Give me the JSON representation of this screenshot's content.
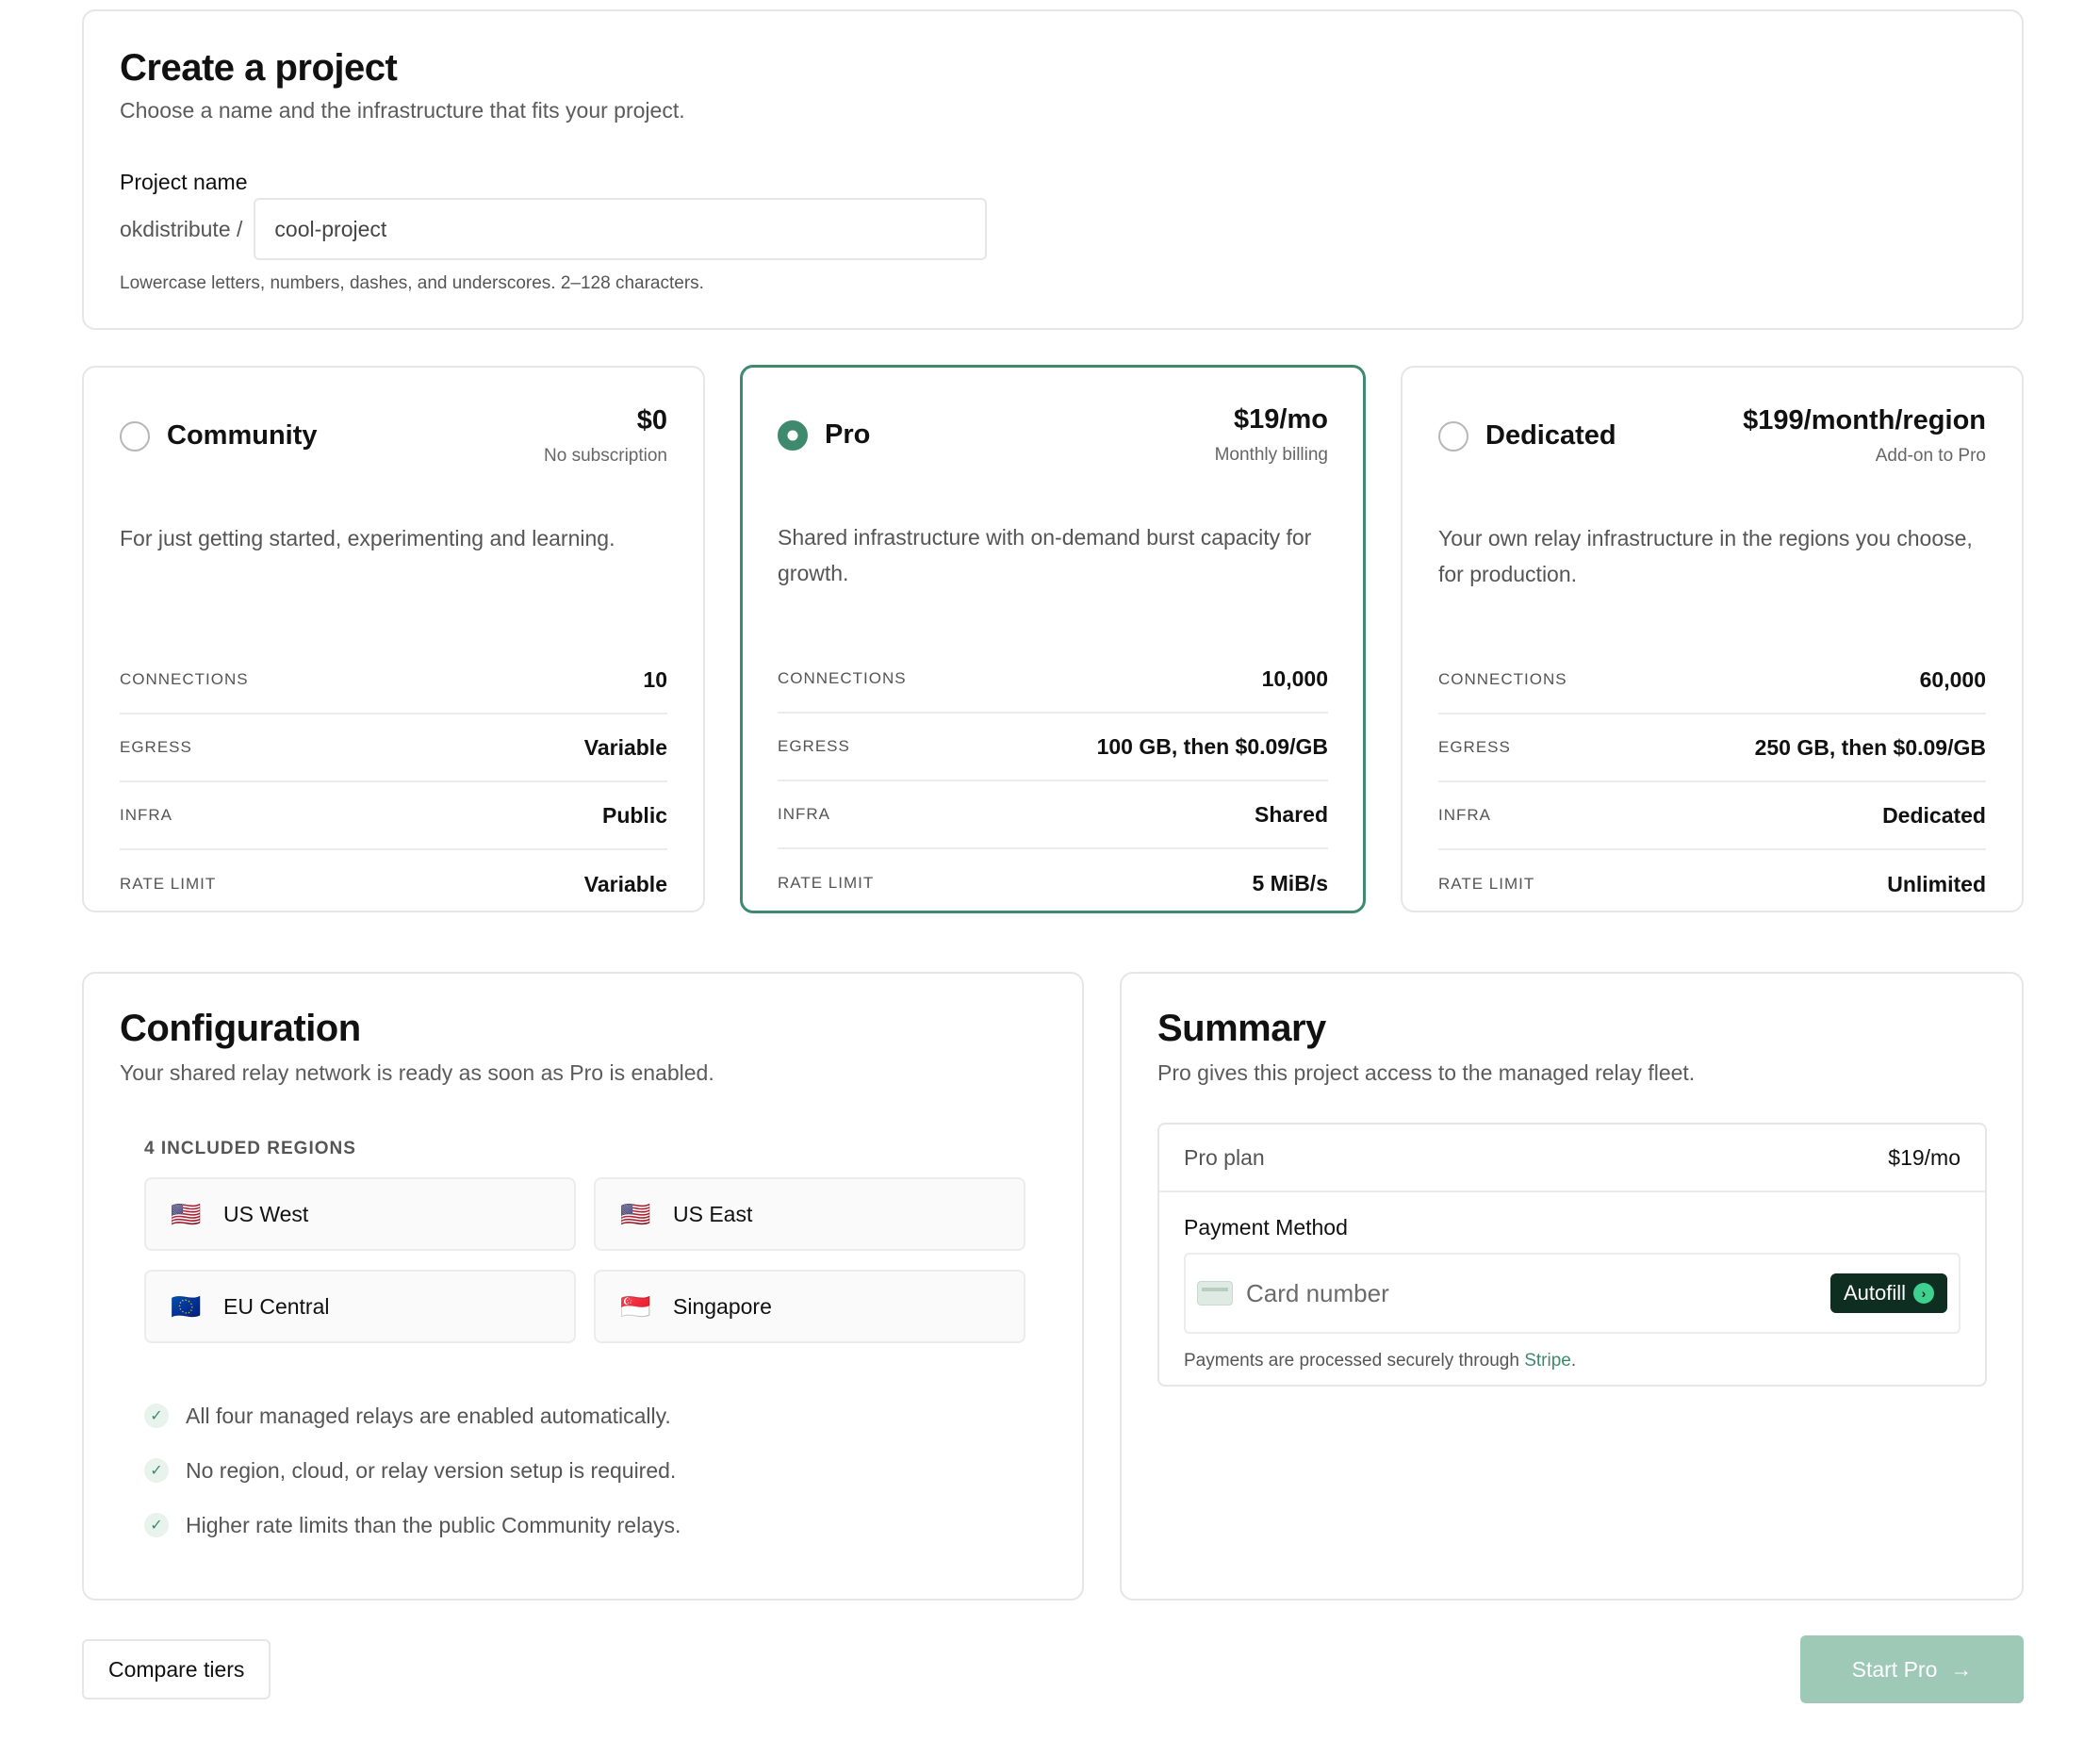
{
  "create": {
    "title": "Create a project",
    "subtitle": "Choose a name and the infrastructure that fits your project.",
    "name_label": "Project name",
    "prefix": "okdistribute /",
    "name_value": "cool-project",
    "hint": "Lowercase letters, numbers, dashes, and underscores. 2–128 characters."
  },
  "plans": [
    {
      "name": "Community",
      "price": "$0",
      "price_note": "No subscription",
      "selected": false,
      "description": "For just getting started, experimenting and learning.",
      "specs": [
        {
          "k": "CONNECTIONS",
          "v": "10"
        },
        {
          "k": "EGRESS",
          "v": "Variable"
        },
        {
          "k": "INFRA",
          "v": "Public"
        },
        {
          "k": "RATE LIMIT",
          "v": "Variable"
        }
      ]
    },
    {
      "name": "Pro",
      "price": "$19/mo",
      "price_note": "Monthly billing",
      "selected": true,
      "description": "Shared infrastructure with on-demand burst capacity for growth.",
      "specs": [
        {
          "k": "CONNECTIONS",
          "v": "10,000"
        },
        {
          "k": "EGRESS",
          "v": "100 GB, then $0.09/GB"
        },
        {
          "k": "INFRA",
          "v": "Shared"
        },
        {
          "k": "RATE LIMIT",
          "v": "5 MiB/s"
        }
      ]
    },
    {
      "name": "Dedicated",
      "price": "$199/month/region",
      "price_note": "Add-on to Pro",
      "selected": false,
      "description": "Your own relay infrastructure in the regions you choose, for production.",
      "specs": [
        {
          "k": "CONNECTIONS",
          "v": "60,000"
        },
        {
          "k": "EGRESS",
          "v": "250 GB, then $0.09/GB"
        },
        {
          "k": "INFRA",
          "v": "Dedicated"
        },
        {
          "k": "RATE LIMIT",
          "v": "Unlimited"
        }
      ]
    }
  ],
  "config": {
    "title": "Configuration",
    "subtitle": "Your shared relay network is ready as soon as Pro is enabled.",
    "regions_label": "4 INCLUDED REGIONS",
    "regions": [
      {
        "flag": "🇺🇸",
        "name": "US West"
      },
      {
        "flag": "🇺🇸",
        "name": "US East"
      },
      {
        "flag": "🇪🇺",
        "name": "EU Central"
      },
      {
        "flag": "🇸🇬",
        "name": "Singapore"
      }
    ],
    "bullets": [
      "All four managed relays are enabled automatically.",
      "No region, cloud, or relay version setup is required.",
      "Higher rate limits than the public Community relays."
    ]
  },
  "summary": {
    "title": "Summary",
    "subtitle": "Pro gives this project access to the managed relay fleet.",
    "plan_label": "Pro plan",
    "plan_price": "$19/mo",
    "payment_label": "Payment Method",
    "card_placeholder": "Card number",
    "autofill_label": "Autofill",
    "note_prefix": "Payments are processed securely through ",
    "note_link": "Stripe",
    "note_suffix": "."
  },
  "footer": {
    "compare_label": "Compare tiers",
    "start_label": "Start Pro"
  },
  "colors": {
    "accent": "#3f8a6e",
    "start_button": "#9fc9b7",
    "autofill_bg": "#0f2e22"
  }
}
